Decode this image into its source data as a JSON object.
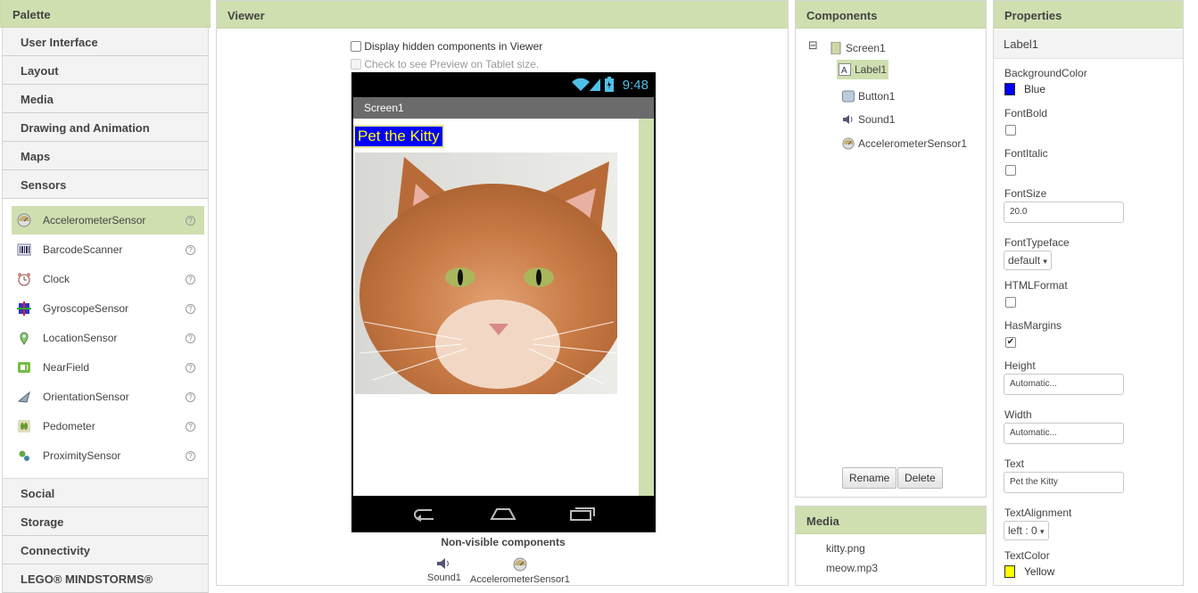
{
  "palette": {
    "title": "Palette",
    "categories_top": [
      "User Interface",
      "Layout",
      "Media",
      "Drawing and Animation",
      "Maps",
      "Sensors"
    ],
    "sensors": [
      {
        "label": "AccelerometerSensor",
        "icon": "accelerometer-icon",
        "selected": true
      },
      {
        "label": "BarcodeScanner",
        "icon": "barcode-icon"
      },
      {
        "label": "Clock",
        "icon": "clock-icon"
      },
      {
        "label": "GyroscopeSensor",
        "icon": "gyroscope-icon"
      },
      {
        "label": "LocationSensor",
        "icon": "location-icon"
      },
      {
        "label": "NearField",
        "icon": "nearfield-icon"
      },
      {
        "label": "OrientationSensor",
        "icon": "orientation-icon"
      },
      {
        "label": "Pedometer",
        "icon": "pedometer-icon"
      },
      {
        "label": "ProximitySensor",
        "icon": "proximity-icon"
      }
    ],
    "help_glyph": "?",
    "categories_bottom": [
      "Social",
      "Storage",
      "Connectivity",
      "LEGO® MINDSTORMS®"
    ]
  },
  "viewer": {
    "title": "Viewer",
    "hidden_components_label": "Display hidden components in Viewer",
    "tablet_preview_label": "Check to see Preview on Tablet size.",
    "phone": {
      "time": "9:48",
      "screen_title": "Screen1",
      "label_text": "Pet the Kitty"
    },
    "nonvisible_title": "Non-visible components",
    "nonvisible": [
      "Sound1",
      "AccelerometerSensor1"
    ]
  },
  "components": {
    "title": "Components",
    "root": "Screen1",
    "collapse_glyph": "⊟",
    "children": [
      {
        "label": "Label1",
        "icon": "label-icon",
        "selected": true
      },
      {
        "label": "Button1",
        "icon": "button-icon"
      },
      {
        "label": "Sound1",
        "icon": "sound-icon"
      },
      {
        "label": "AccelerometerSensor1",
        "icon": "accelerometer-icon"
      }
    ],
    "rename_label": "Rename",
    "delete_label": "Delete"
  },
  "media": {
    "title": "Media",
    "files": [
      "kitty.png",
      "meow.mp3"
    ]
  },
  "properties": {
    "title": "Properties",
    "component": "Label1",
    "BackgroundColor": {
      "name": "BackgroundColor",
      "value": "Blue",
      "color": "#0000ff"
    },
    "FontBold": {
      "name": "FontBold",
      "checked": false
    },
    "FontItalic": {
      "name": "FontItalic",
      "checked": false
    },
    "FontSize": {
      "name": "FontSize",
      "value": "20.0"
    },
    "FontTypeface": {
      "name": "FontTypeface",
      "value": "default"
    },
    "HTMLFormat": {
      "name": "HTMLFormat",
      "checked": false
    },
    "HasMargins": {
      "name": "HasMargins",
      "checked": true
    },
    "Height": {
      "name": "Height",
      "value": "Automatic..."
    },
    "Width": {
      "name": "Width",
      "value": "Automatic..."
    },
    "Text": {
      "name": "Text",
      "value": "Pet the Kitty"
    },
    "TextAlignment": {
      "name": "TextAlignment",
      "value": "left : 0"
    },
    "TextColor": {
      "name": "TextColor",
      "value": "Yellow",
      "color": "#ffff00"
    },
    "dropdown_glyph": "▾",
    "check_glyph": "✔"
  },
  "colors": {
    "accent": "#cfdfb0",
    "label_bg": "#0000ff",
    "label_fg": "#ffff00",
    "time": "#4fc1e9"
  }
}
